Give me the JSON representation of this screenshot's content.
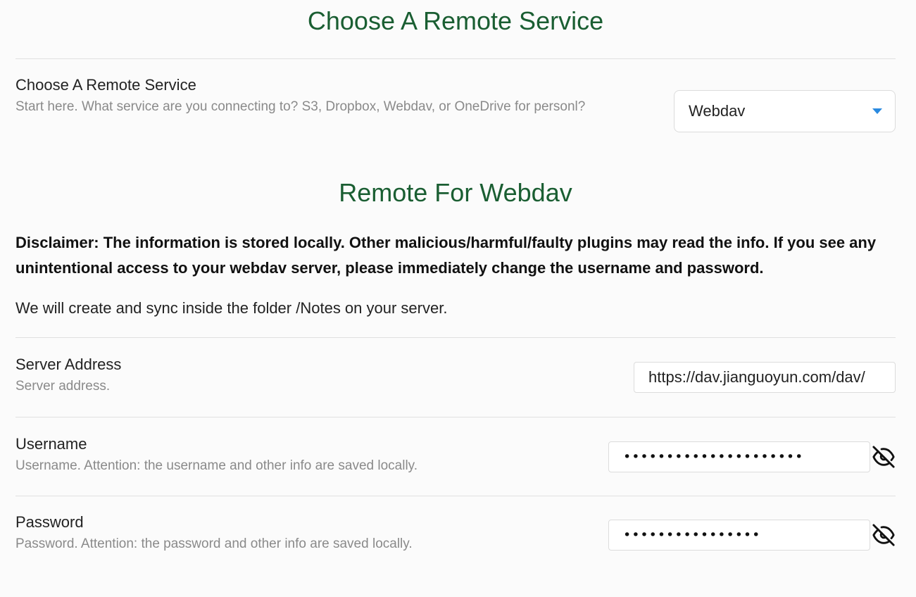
{
  "section1": {
    "title": "Choose A Remote Service",
    "setting": {
      "name": "Choose A Remote Service",
      "desc": "Start here. What service are you connecting to? S3, Dropbox, Webdav, or OneDrive for personl?",
      "selected": "Webdav"
    }
  },
  "section2": {
    "title": "Remote For Webdav",
    "disclaimer": "Disclaimer: The information is stored locally. Other malicious/harmful/faulty plugins may read the info. If you see any unintentional access to your webdav server, please immediately change the username and password.",
    "info": "We will create and sync inside the folder /Notes on your server.",
    "server": {
      "name": "Server Address",
      "desc": "Server address.",
      "value": "https://dav.jianguoyun.com/dav/"
    },
    "username": {
      "name": "Username",
      "desc": "Username. Attention: the username and other info are saved locally.",
      "masked": "•••••••••••••••••••••"
    },
    "password": {
      "name": "Password",
      "desc": "Password. Attention: the password and other info are saved locally.",
      "masked": "••••••••••••••••"
    }
  },
  "colors": {
    "heading": "#1a5e32",
    "accent": "#2a8ae0"
  },
  "icons": {
    "dropdown": "chevron-down-icon",
    "visibility": "eye-off-icon"
  }
}
